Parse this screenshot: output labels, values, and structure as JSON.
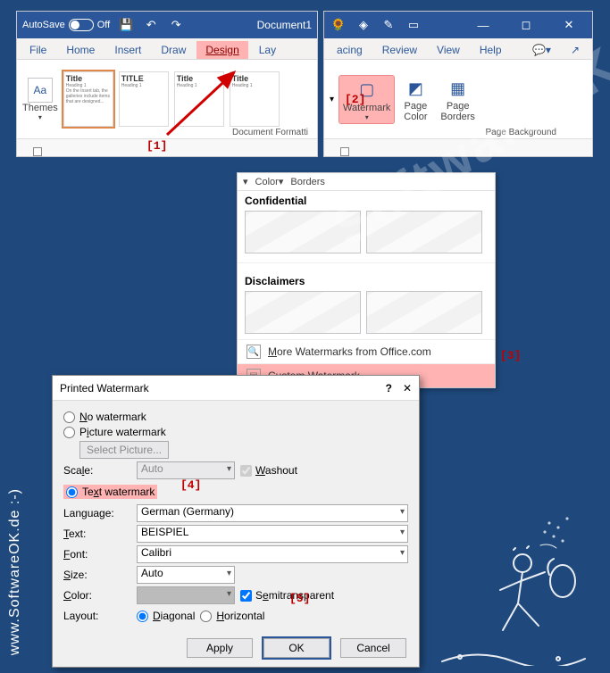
{
  "titlebar": {
    "autosave": "AutoSave",
    "off": "Off",
    "doc": "Document1"
  },
  "tabs1": {
    "file": "File",
    "home": "Home",
    "insert": "Insert",
    "draw": "Draw",
    "design": "Design",
    "lay": "Lay"
  },
  "tabs2": {
    "acing": "acing",
    "review": "Review",
    "view": "View",
    "help": "Help"
  },
  "ribbon1": {
    "themes": "Themes",
    "title": "Title",
    "TITLE": "TITLE",
    "Title": "Title",
    "heading1": "Heading 1",
    "group": "Document Formatti"
  },
  "ribbon2": {
    "watermark": "Watermark",
    "pagecolor": "Page\nColor",
    "pageborders": "Page\nBorders",
    "group": "Page Background"
  },
  "gallery": {
    "head1": "Color",
    "head2": "Borders",
    "cat1": "Confidential",
    "cat2": "Disclaimers",
    "more": "More Watermarks from Office.com",
    "custom": "Custom Watermark..."
  },
  "dialog": {
    "title": "Printed Watermark",
    "radio_none": "No watermark",
    "radio_pic": "Picture watermark",
    "selpic": "Select Picture...",
    "scale": "Scale:",
    "auto": "Auto",
    "washout": "Washout",
    "radio_text": "Text watermark",
    "language": "Language:",
    "lang_val": "German (Germany)",
    "text": "Text:",
    "text_val": "BEISPIEL",
    "font": "Font:",
    "font_val": "Calibri",
    "size": "Size:",
    "color": "Color:",
    "semi": "Semitransparent",
    "layout": "Layout:",
    "diag": "Diagonal",
    "horiz": "Horizontal",
    "apply": "Apply",
    "ok": "OK",
    "cancel": "Cancel"
  },
  "markers": {
    "m1": "[1]",
    "m2": "[2]",
    "m3": "[3]",
    "m4": "[4]",
    "m5": "[5]"
  },
  "side": "www.SoftwareOK.de :-)",
  "diag_wm": "SoftwareOK.com"
}
